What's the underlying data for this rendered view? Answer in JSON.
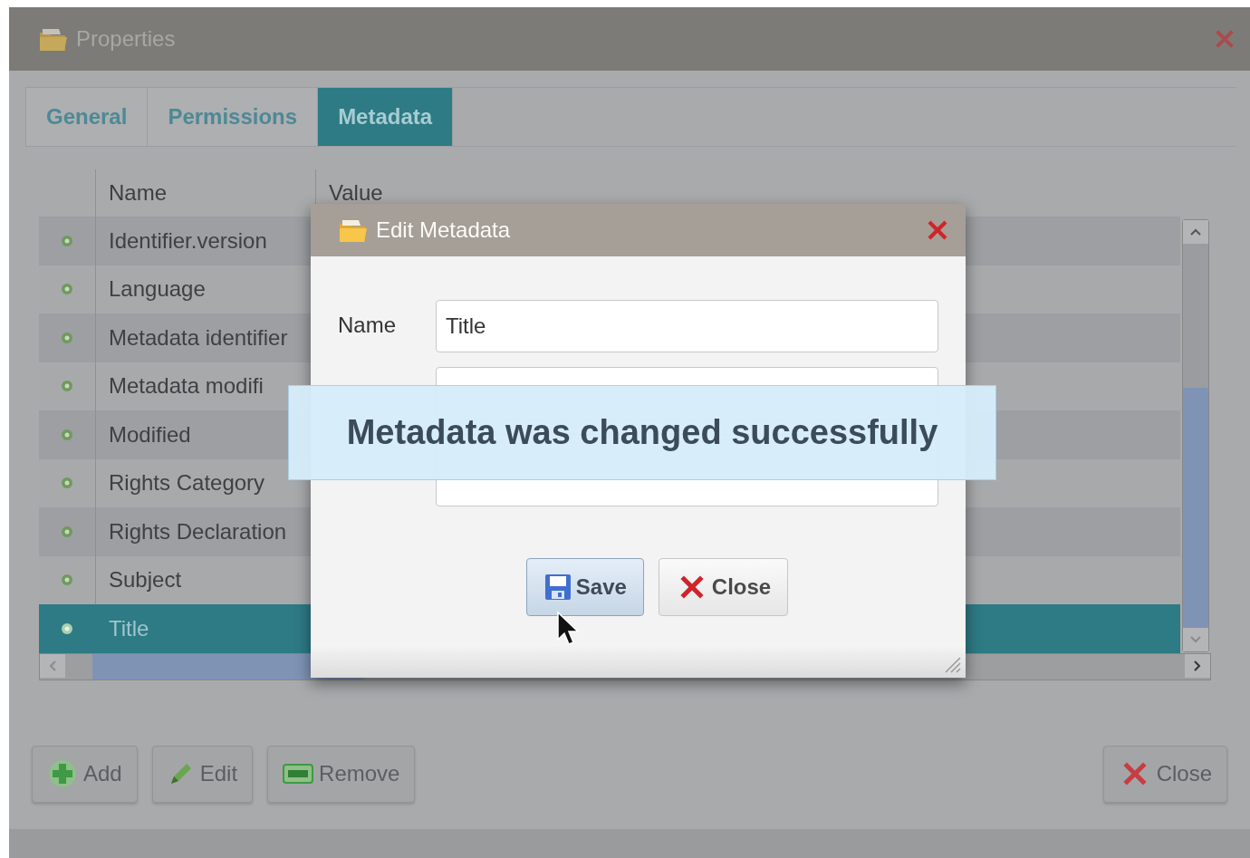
{
  "window": {
    "title": "Properties"
  },
  "tabs": [
    {
      "label": "General",
      "selected": false
    },
    {
      "label": "Permissions",
      "selected": false
    },
    {
      "label": "Metadata",
      "selected": true
    }
  ],
  "table": {
    "columns": [
      "Name",
      "Value"
    ],
    "rows": [
      {
        "name": "Identifier.version",
        "selected": false
      },
      {
        "name": "Language",
        "selected": false
      },
      {
        "name": "Metadata identifier",
        "selected": false
      },
      {
        "name": "Metadata modifi",
        "selected": false
      },
      {
        "name": "Modified",
        "selected": false
      },
      {
        "name": "Rights Category",
        "selected": false
      },
      {
        "name": "Rights Declaration",
        "selected": false
      },
      {
        "name": "Subject",
        "selected": false
      },
      {
        "name": "Title",
        "selected": true
      }
    ]
  },
  "buttons": [
    {
      "label": "Add",
      "kind": "add"
    },
    {
      "label": "Edit",
      "kind": "edit"
    },
    {
      "label": "Remove",
      "kind": "remove"
    }
  ],
  "close_button": {
    "label": "Close"
  },
  "dialog": {
    "title": "Edit Metadata",
    "fields": [
      {
        "label": "Name",
        "value": "Title",
        "kind": "input"
      },
      {
        "kind": "input"
      },
      {
        "kind": "area"
      }
    ],
    "buttons": [
      {
        "label": "Save",
        "kind": "save",
        "hovered": true
      },
      {
        "label": "Close",
        "kind": "close",
        "hovered": false
      }
    ]
  },
  "toast": {
    "message": "Metadata was changed successfully"
  }
}
